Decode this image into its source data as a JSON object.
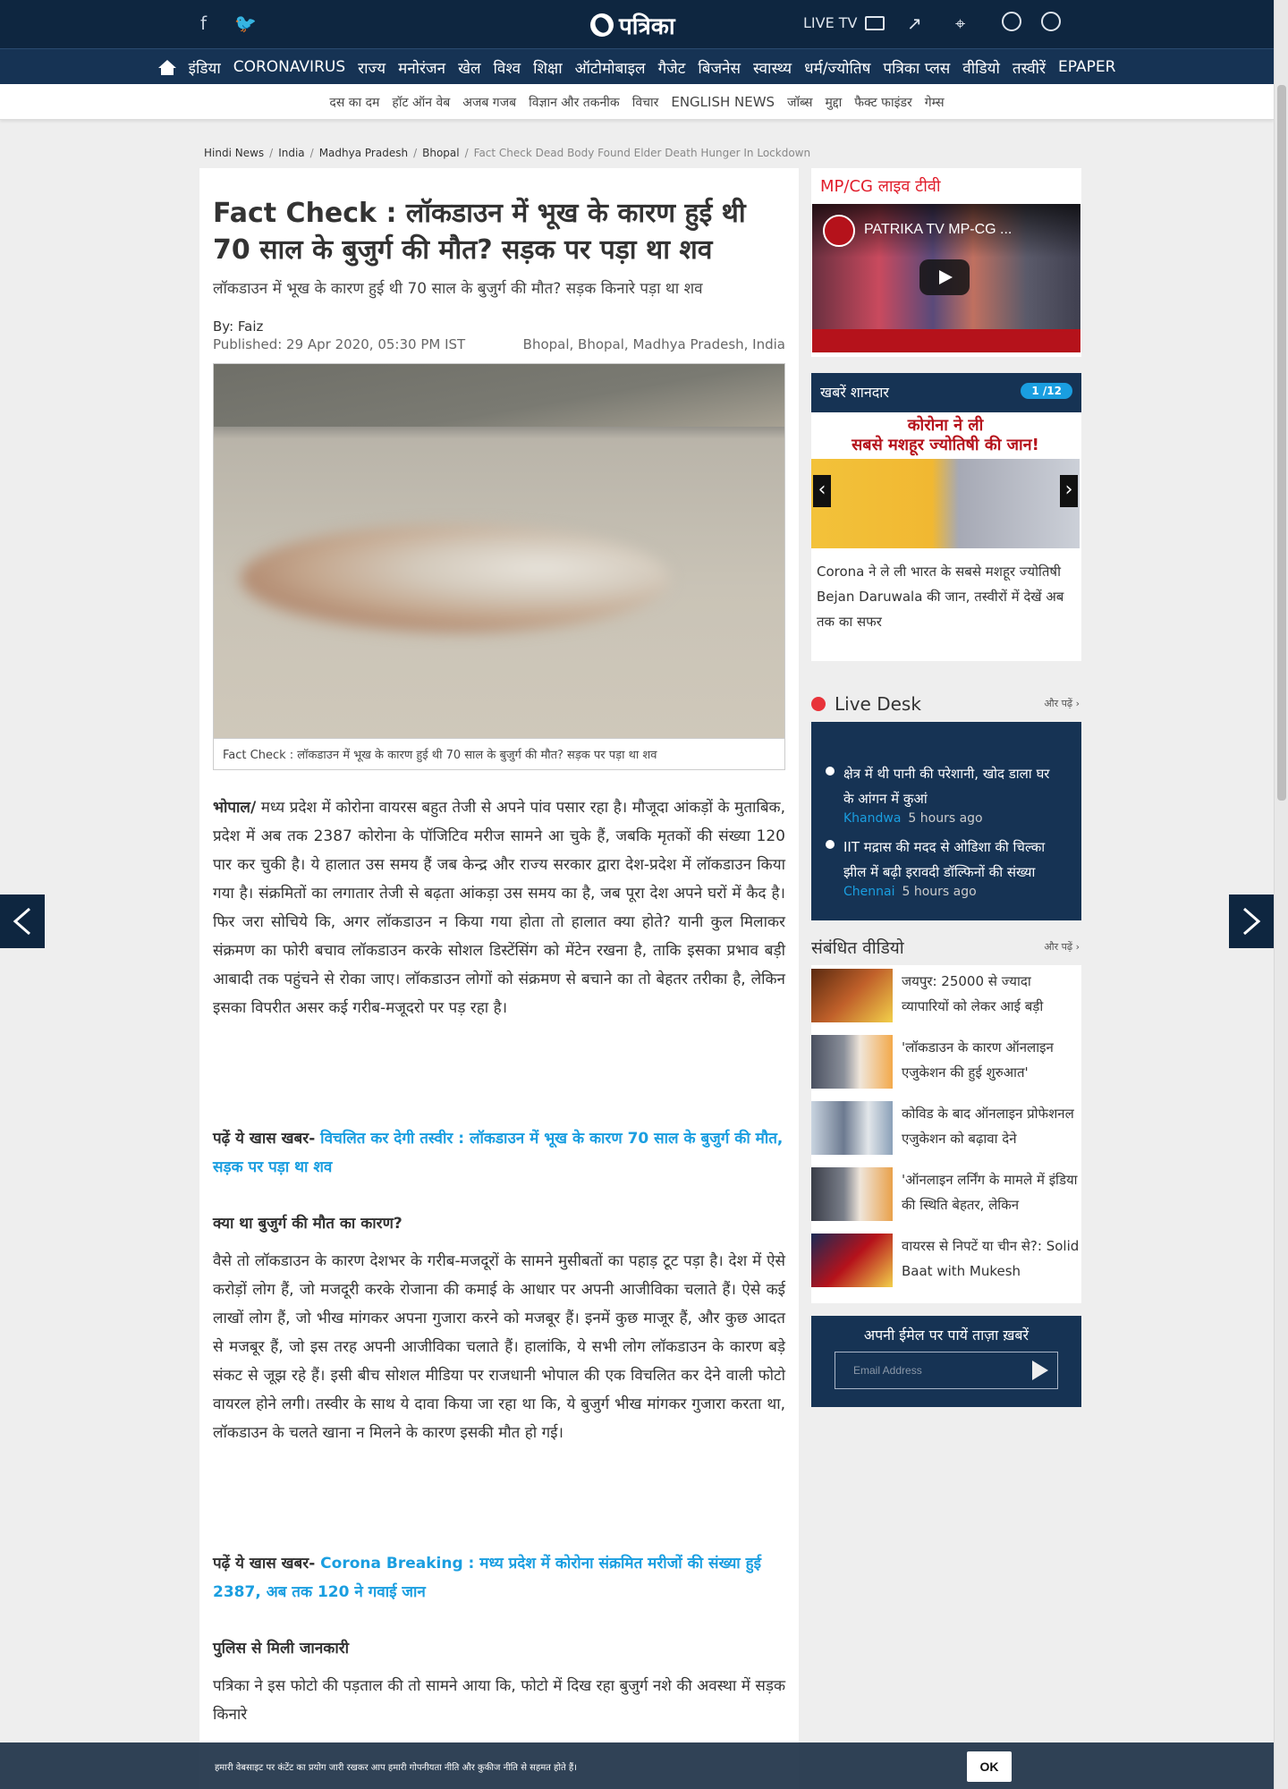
{
  "topbar": {
    "logo_text": "पत्रिका",
    "live_tv": "LIVE TV"
  },
  "nav": {
    "items": [
      "इंडिया",
      "CORONAVIRUS",
      "राज्य",
      "मनोरंजन",
      "खेल",
      "विश्व",
      "शिक्षा",
      "ऑटोमोबाइल",
      "गैजेट",
      "बिजनेस",
      "स्वास्थ्य",
      "धर्म/ज्योतिष",
      "पत्रिका प्लस",
      "वीडियो",
      "तस्वीरें",
      "EPAPER"
    ]
  },
  "subnav": {
    "items": [
      "दस का दम",
      "हॉट ऑन वेब",
      "अजब गजब",
      "विज्ञान और तकनीक",
      "विचार",
      "ENGLISH NEWS",
      "जॉब्स",
      "मुद्दा",
      "फैक्ट फाइंडर",
      "गेम्स"
    ]
  },
  "breadcrumb": [
    "Hindi News",
    "India",
    "Madhya Pradesh",
    "Bhopal",
    "Fact Check Dead Body Found Elder Death Hunger In Lockdown"
  ],
  "article": {
    "title": "Fact Check : लॉकडाउन में भूख के कारण हुई थी 70 साल के बुजुर्ग की मौत? सड़क पर पड़ा था शव",
    "subtitle": "लॉकडाउन में भूख के कारण हुई थी 70 साल के बुजुर्ग की मौत? सड़क किनारे पड़ा था शव",
    "byline": "By: Faiz",
    "published": "Published: 29 Apr 2020, 05:30 PM IST",
    "location": "Bhopal, Bhopal, Madhya Pradesh, India",
    "caption": "Fact Check : लॉकडाउन में भूख के कारण हुई थी 70 साल के बुजुर्ग की मौत? सड़क पर पड़ा था शव",
    "p1_lead": "भोपाल/",
    "p1": " मध्य प्रदेश में कोरोना वायरस बहुत तेजी से अपने पांव पसार रहा है। मौजूदा आंकड़ों के मुताबिक, प्रदेश में अब तक 2387 कोरोना के पॉजिटिव मरीज सामने आ चुके हैं, जबकि मृतकों की संख्या 120 पार कर चुकी है। ये हालात उस समय हैं जब केन्द्र और राज्य सरकार द्वारा देश-प्रदेश में लॉकडाउन किया गया है। संक्रमितों का लगातार तेजी से बढ़ता आंकड़ा उस समय का है, जब पूरा देश अपने घरों में कैद है। फिर जरा सोचिये कि, अगर लॉकडाउन न किया गया होता तो हालात क्या होते? यानी कुल मिलाकर संक्रमण का फोरी बचाव लॉकडाउन करके सोशल डिस्टेंसिंग को मेंटेन रखना है, ताकि इसका प्रभाव बड़ी आबादी तक पहुंचने से रोका जाए। लॉकडाउन लोगों को संक्रमण से बचाने का तो बेहतर तरीका है, लेकिन इसका विपरीत असर कई गरीब-मजूदरो पर पड़ रहा है।",
    "rm1_label": "पढ़ें ये खास खबर-",
    "rm1_link": " विचलित कर देगी तस्वीर : लॉकडाउन में भूख के कारण 70 साल के बुजुर्ग की मौत, सड़क पर पड़ा था शव",
    "h2a": "क्या था बुजुर्ग की मौत का कारण?",
    "p2": "वैसे तो लॉकडाउन के कारण देशभर के गरीब-मजदूरों के सामने मुसीबतों का पहाड़ टूट पड़ा है। देश में ऐसे करोड़ों लोग हैं, जो मजदूरी करके रोजाना की कमाई के आधार पर अपनी आजीविका चलाते हैं। ऐसे कई लाखों लोग हैं, जो भीख मांगकर अपना गुजारा करने को मजबूर हैं। इनमें कुछ माजूर हैं, और कुछ आदत से मजबूर हैं, जो इस तरह अपनी आजीविका चलाते हैं। हालांकि, ये सभी लोग लॉकडाउन के कारण बड़े संकट से जूझ रहे हैं। इसी बीच सोशल मीडिया पर राजधानी भोपाल की एक विचलित कर देने वाली फोटो वायरल होने लगी। तस्वीर के साथ ये दावा किया जा रहा था कि, ये बुजुर्ग भीख मांगकर गुजारा करता था, लॉकडाउन के चलते खाना न मिलने के कारण इसकी मौत हो गई।",
    "rm2_label": "पढ़ें ये खास खबर-",
    "rm2_link": " Corona Breaking : मध्य प्रदेश में कोरोना संक्रमित मरीजों की संख्या हुई 2387, अब तक 120 ने गवाई जान",
    "h2b": "पुलिस से मिली जानकारी",
    "p3": "पत्रिका ने इस फोटो की पड़ताल की तो सामने आया कि, फोटो में दिख रहा बुजुर्ग नशे की अवस्था में सड़क किनारे"
  },
  "sidebar": {
    "mpcg_title": "MP/CG लाइव टीवी",
    "video_title": "PATRIKA TV MP-CG ...",
    "khabre_title": "खबरें शानदार",
    "khabre_pager": "1 /12",
    "khabre_banner_1": "कोरोना ने ली",
    "khabre_banner_2": "सबसे मशहूर ज्योतिषी की जान!",
    "khabre_text": "Corona ने ले ली भारत के सबसे मशहूर ज्योतिषी Bejan Daruwala की जान, तस्वीरों में देखें अब तक का सफर",
    "live_desk_title": "Live Desk",
    "more_label": "और पढ़ें",
    "live_items": [
      {
        "text": "क्षेत्र में थी पानी की परेशानी, खोद डाला घर के आंगन में कुआं",
        "city": "Khandwa",
        "time": "5 hours ago"
      },
      {
        "text": "IIT मद्रास की मदद से ओडिशा की चिल्का झील में बढ़ी इरावदी डॉल्फिनों की संख्या",
        "city": "Chennai",
        "time": "5 hours ago"
      }
    ],
    "videos_title": "संबंधित वीडियो",
    "videos": [
      "जयपुर: 25000 से ज्यादा व्यापारियों को लेकर आई बड़ी",
      "'लॉकडाउन के कारण ऑनलाइन एजुकेशन की हुई शुरुआत'",
      "कोविड के बाद ऑनलाइन प्रोफेशनल एजुकेशन को बढ़ावा देने",
      "'ऑनलाइन लर्निंग के मामले में इंडिया की स्थिति बेहतर, लेकिन",
      "वायरस से निपटें या चीन से?: Solid Baat with Mukesh"
    ],
    "email_title": "अपनी ईमेल पर पायें ताज़ा ख़बरें",
    "email_placeholder": "Email Address"
  },
  "cookie": {
    "text": "हमारी वेबसाइट पर कंटेंट का प्रयोग जारी रखकर आप हमारी गोपनीयता नीति और कुकीज नीति से सहमत होते हैं।",
    "ok": "OK"
  }
}
